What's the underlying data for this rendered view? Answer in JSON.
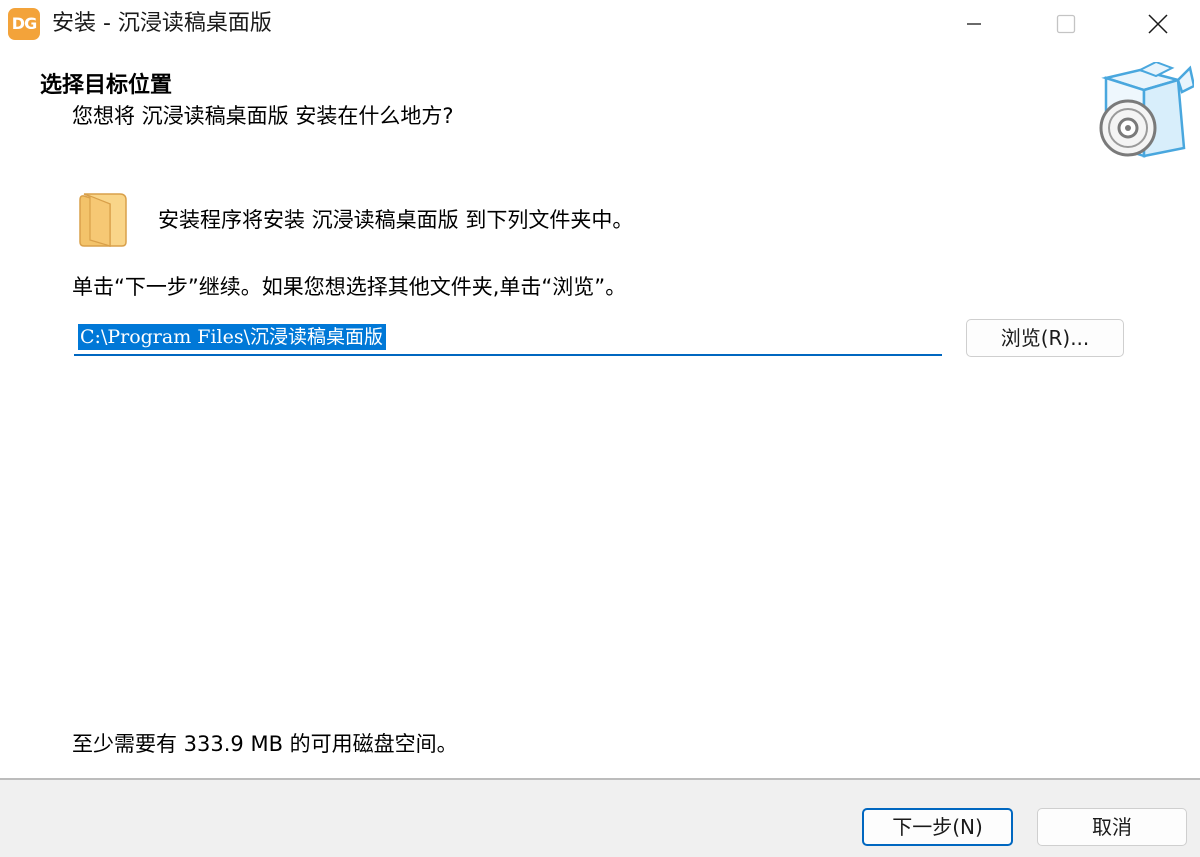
{
  "window": {
    "title": "安装 - 沉浸读稿桌面版",
    "app_icon_text": "DG",
    "controls": [
      "minimize-icon",
      "maximize-icon",
      "close-icon"
    ]
  },
  "header": {
    "title": "选择目标位置",
    "subtitle": "您想将 沉浸读稿桌面版 安装在什么地方?",
    "art_icon": "box-disc-icon"
  },
  "main": {
    "folder_icon": "folder-icon",
    "info_text": "安装程序将安装 沉浸读稿桌面版 到下列文件夹中。",
    "hint_text": "单击“下一步”继续。如果您想选择其他文件夹,单击“浏览”。",
    "path_value": "C:\\Program Files\\沉浸读稿桌面版",
    "browse_label": "浏览(R)...",
    "space_text": "至少需要有 333.9 MB 的可用磁盘空间。"
  },
  "footer": {
    "next_label": "下一步(N)",
    "cancel_label": "取消"
  },
  "colors": {
    "accent": "#0067c0",
    "selection": "#0078d7",
    "app_icon": "#f3a33a",
    "folder": "#f8cf7c",
    "footer_bg": "#f0f0f0"
  }
}
